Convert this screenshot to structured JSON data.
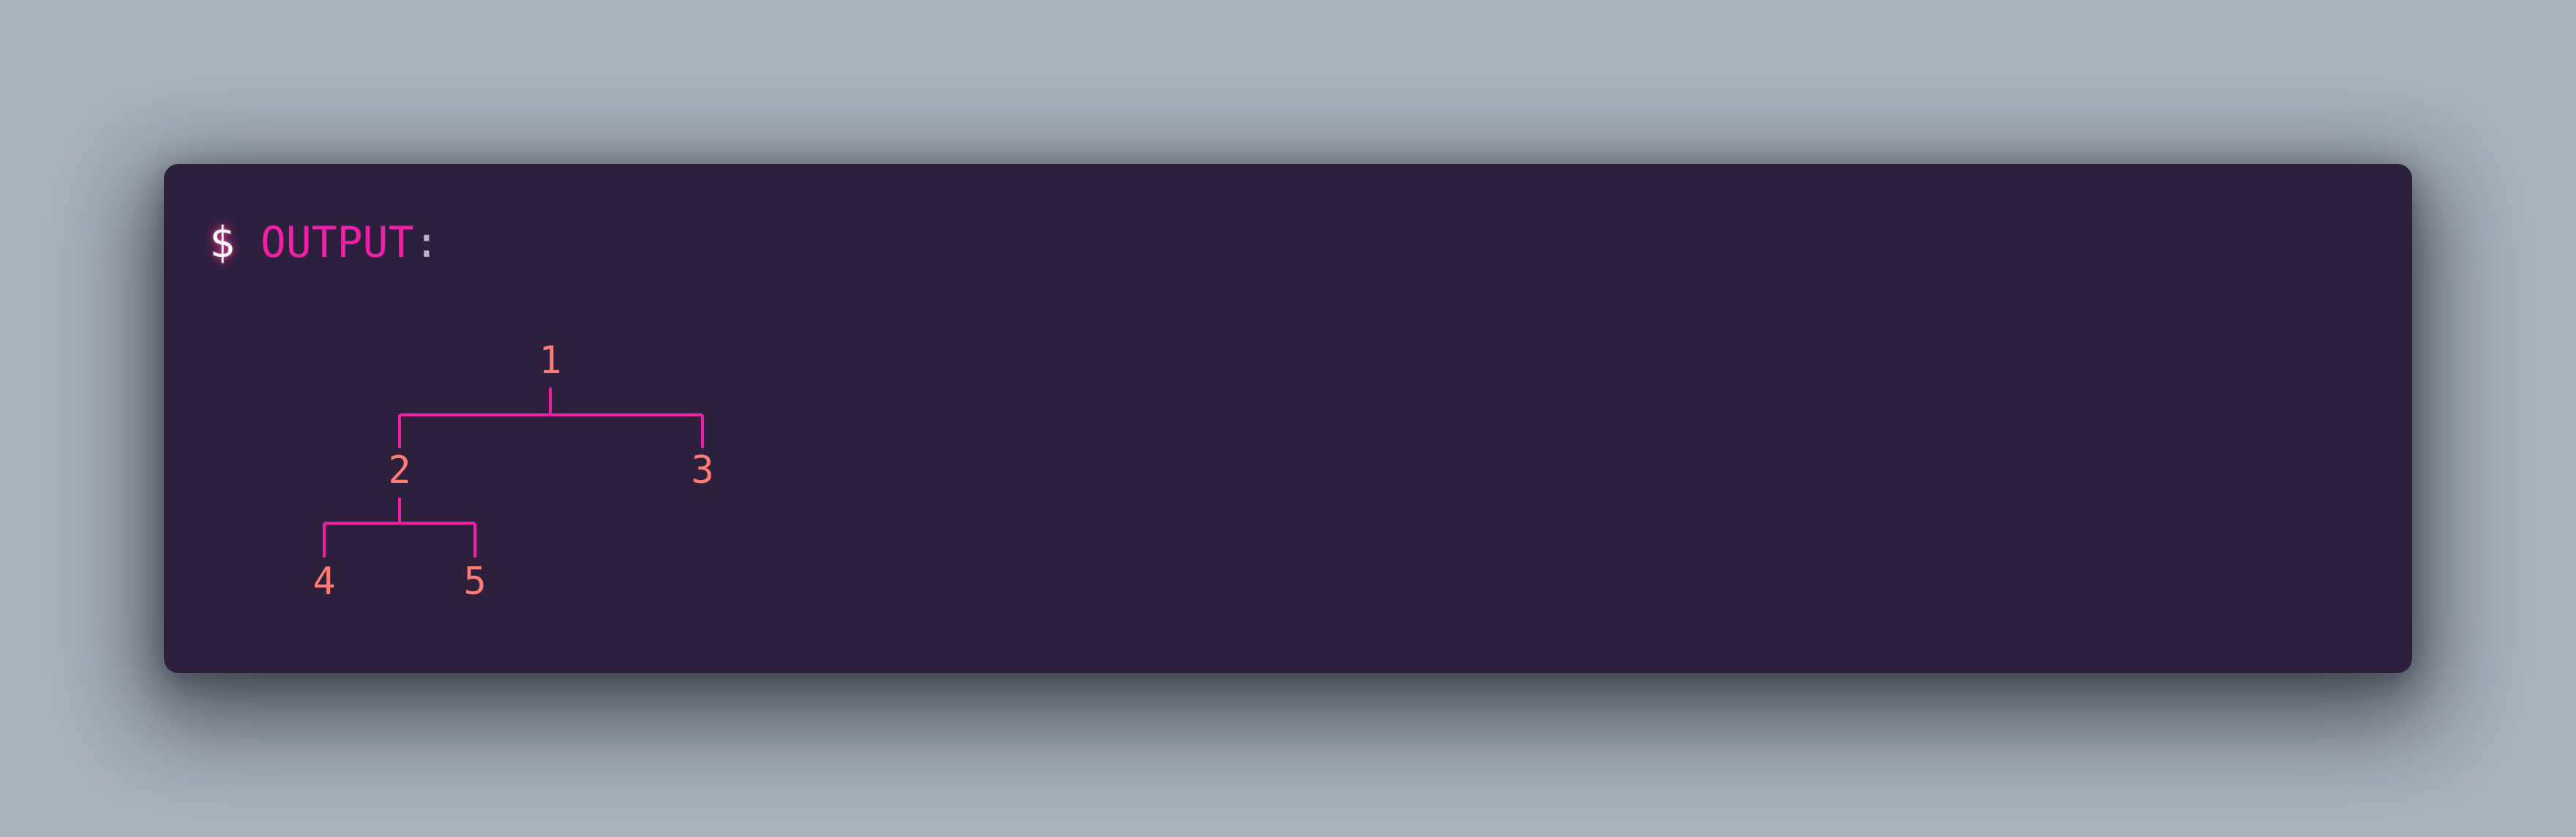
{
  "terminal": {
    "prompt_symbol": "$",
    "label": "OUTPUT",
    "colon": ":"
  },
  "tree": {
    "root": "1",
    "left": "2",
    "right": "3",
    "left_left": "4",
    "left_right": "5"
  },
  "colors": {
    "background": "#a8b2bd",
    "terminal_bg": "#2d203c",
    "accent": "#f21ea6",
    "node_text": "#ff7b73",
    "colon": "#b9b3c2"
  }
}
